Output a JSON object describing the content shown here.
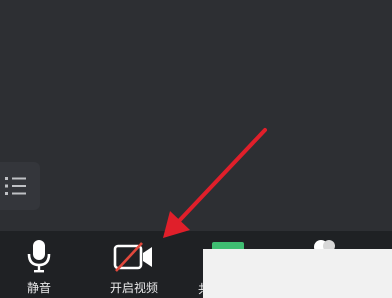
{
  "toolbar": {
    "mute_label": "静音",
    "video_label": "开启视频"
  },
  "icons": {
    "list": "list-icon",
    "mute": "microphone-icon",
    "video": "video-off-icon",
    "share": "share-screen-icon",
    "members": "members-icon"
  },
  "colors": {
    "background": "#2d2f33",
    "toolbar": "#1f2124",
    "video_slash": "#e0483c",
    "share_green": "#3fbe72",
    "arrow": "#e01f2a"
  }
}
